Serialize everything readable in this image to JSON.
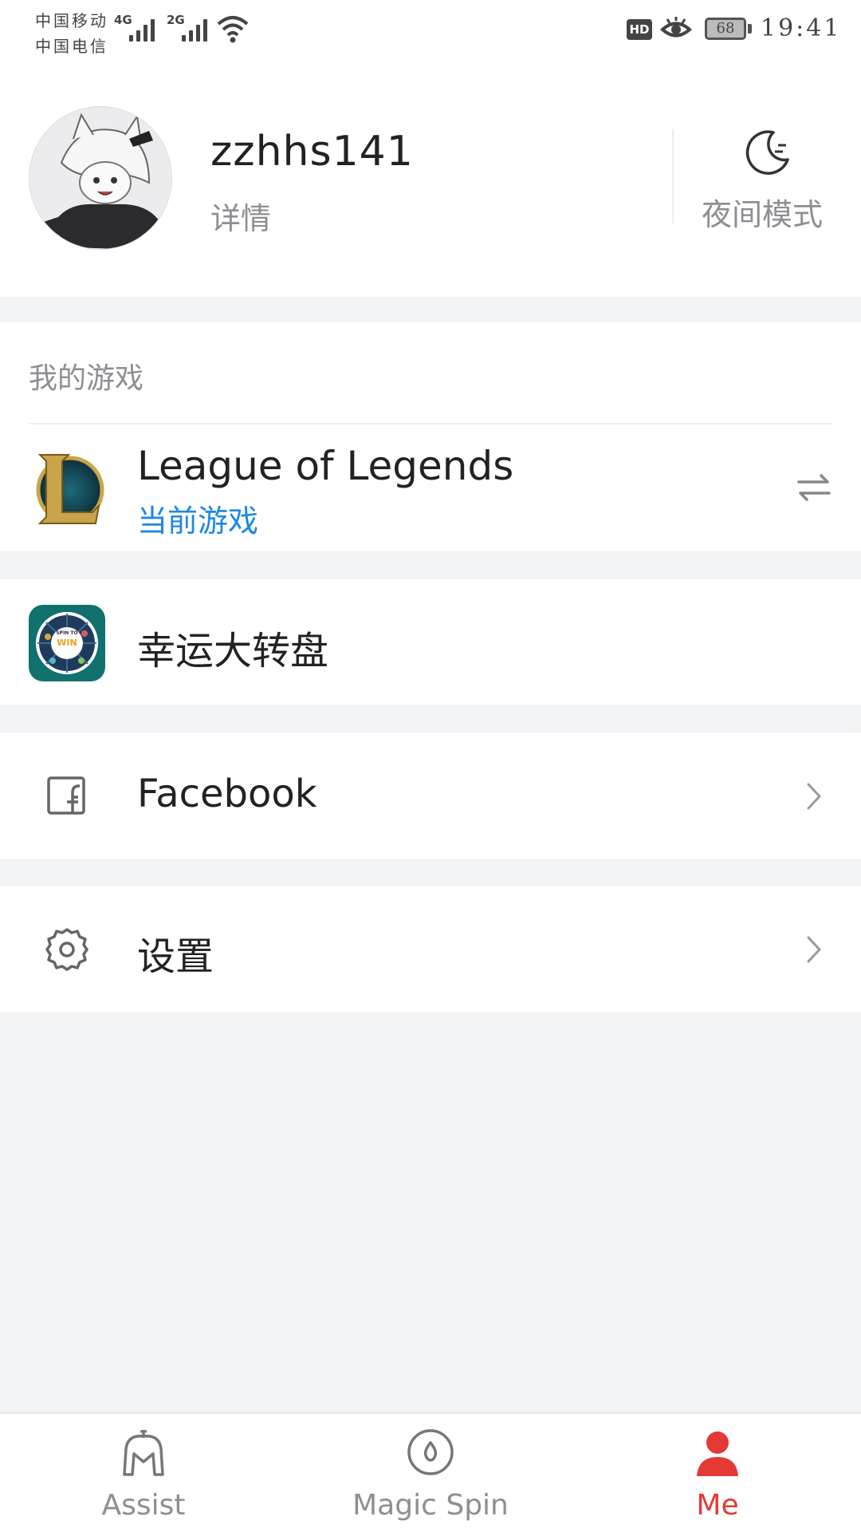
{
  "status_bar": {
    "carrier_1": "中国移动",
    "carrier_2": "中国电信",
    "network_1": "4G",
    "network_2": "2G",
    "hd_badge": "HD",
    "battery_level": "68",
    "time": "19:41",
    "icons": [
      "signal-icon",
      "wifi-icon",
      "eye-icon",
      "battery-icon"
    ]
  },
  "profile": {
    "username": "zzhhs141",
    "details_link": "详情",
    "night_mode_label": "夜间模式"
  },
  "my_games": {
    "section_title": "我的游戏",
    "current_game": {
      "title": "League of Legends",
      "subtitle": "当前游戏"
    }
  },
  "lucky_wheel": {
    "label": "幸运大转盘",
    "icon_text_top": "SPIN TO",
    "icon_text_mid": "WIN"
  },
  "facebook": {
    "label": "Facebook"
  },
  "settings": {
    "label": "设置"
  },
  "bottom_nav": {
    "items": [
      {
        "label": "Assist",
        "active": false
      },
      {
        "label": "Magic Spin",
        "active": false
      },
      {
        "label": "Me",
        "active": true
      }
    ]
  },
  "colors": {
    "accent_blue": "#1e88e5",
    "active_red": "#e53935",
    "muted_gray": "#8e8e93",
    "background": "#f3f4f6"
  }
}
